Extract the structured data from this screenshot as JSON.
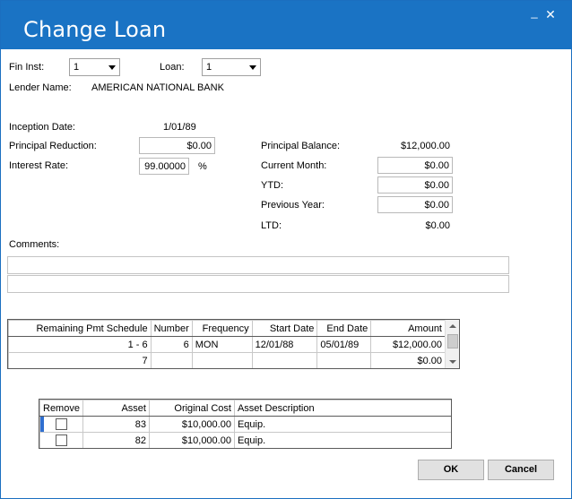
{
  "window": {
    "title": "Change Loan",
    "minimize": "_",
    "close": "✕"
  },
  "header": {
    "fin_inst_label": "Fin Inst:",
    "fin_inst_value": "1",
    "loan_label": "Loan:",
    "loan_value": "1",
    "lender_label": "Lender Name:",
    "lender_value": "AMERICAN NATIONAL BANK"
  },
  "left": {
    "inception_label": "Inception Date:",
    "inception_value": "1/01/89",
    "principal_reduction_label": "Principal Reduction:",
    "principal_reduction_value": "$0.00",
    "interest_label": "Interest Rate:",
    "interest_value": "99.00000",
    "interest_unit": "%"
  },
  "right": {
    "principal_balance_label": "Principal Balance:",
    "principal_balance_value": "$12,000.00",
    "current_month_label": "Current Month:",
    "current_month_value": "$0.00",
    "ytd_label": "YTD:",
    "ytd_value": "$0.00",
    "prev_year_label": "Previous Year:",
    "prev_year_value": "$0.00",
    "ltd_label": "LTD:",
    "ltd_value": "$0.00"
  },
  "comments": {
    "label": "Comments:",
    "line1": "",
    "line2": ""
  },
  "schedule": {
    "headers": [
      "Remaining Pmt Schedule",
      "Number",
      "Frequency",
      "Start Date",
      "End Date",
      "Amount"
    ],
    "rows": [
      [
        "1 -   6",
        "6",
        "MON",
        "12/01/88",
        "05/01/89",
        "$12,000.00"
      ],
      [
        "7",
        "",
        "",
        "",
        "",
        "$0.00"
      ]
    ]
  },
  "assets": {
    "headers": [
      "Remove",
      "Asset",
      "Original Cost",
      "Asset Description"
    ],
    "rows": [
      {
        "asset": "83",
        "cost": "$10,000.00",
        "desc": "Equip."
      },
      {
        "asset": "82",
        "cost": "$10,000.00",
        "desc": "Equip."
      }
    ]
  },
  "buttons": {
    "ok": "OK",
    "cancel": "Cancel"
  },
  "colors": {
    "titlebar": "#1a73c4",
    "selection": "#2f6fd0"
  }
}
